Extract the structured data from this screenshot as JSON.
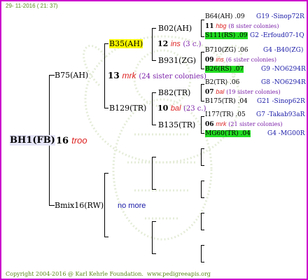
{
  "header": {
    "date": "29- 11-2016 ( 21: 37)"
  },
  "footer": {
    "copyright": "Copyright 2004-2016 @ Karl Kehrle Foundation.",
    "url": "www.pedigreeapis.org"
  },
  "subject": {
    "name": "BH1(FB)",
    "num": "16",
    "breeder": "troo"
  },
  "father_gen1": {
    "name": "B75(AH)",
    "num": "13",
    "breeder": "mrk",
    "sisters": "(24 sister colonies)"
  },
  "mother_gen1": {
    "name": "Bmix16(RW)",
    "note": "no more"
  },
  "g2a": {
    "name": "B35(AH)",
    "num": "12",
    "breeder": "ins",
    "sisters": "(3 c.)"
  },
  "g2b": {
    "name": "B129(TR)",
    "num": "10",
    "breeder": "bal",
    "sisters": "(23 c.)"
  },
  "g3": {
    "b02": "B02(AH)",
    "b931": "B931(ZG)",
    "b82": "B82(TR)",
    "b135": "B135(TR)"
  },
  "g4": [
    {
      "name": "B64(AH)",
      "score": ".09",
      "code": "G19 -Sinop72R",
      "highlight": ""
    },
    {
      "num": "11",
      "breeder": "hbg",
      "sisters": "(8 sister colonies)"
    },
    {
      "name": "S111(RS)",
      "score": ".09",
      "code": "G2 -Erfoud07-1Q",
      "highlight": "green"
    },
    {
      "name": "B710(ZG)",
      "score": ".06",
      "code": "G4 -B40(ZG)",
      "highlight": ""
    },
    {
      "num": "09",
      "breeder": "ins",
      "sisters": "(6 sister colonies)"
    },
    {
      "name": "B26(RS)",
      "score": ".07",
      "code": "G9 -NO6294R",
      "highlight": "green"
    },
    {
      "name": "B2(TR)",
      "score": ".06",
      "code": "G8 -NO6294R",
      "highlight": ""
    },
    {
      "num": "07",
      "breeder": "bal",
      "sisters": "(19 sister colonies)"
    },
    {
      "name": "B175(TR)",
      "score": ".04",
      "code": "G21 -Sinop62R",
      "highlight": ""
    },
    {
      "name": "I177(TR)",
      "score": ".05",
      "code": "G7 -Takab93aR",
      "highlight": ""
    },
    {
      "num": "06",
      "breeder": "mrk",
      "sisters": "(21 sister colonies)"
    },
    {
      "name": "MG60(TR)",
      "score": ".04",
      "code": "G4 -MG00R",
      "highlight": "green"
    }
  ],
  "colors": {
    "border": "#cc00cc",
    "highlight_yellow": "#ffff00",
    "highlight_green": "#22dd22",
    "breeder_red": "#dd2222",
    "sister_purple": "#7a1fa8",
    "code_blue": "#1a1aa8",
    "meta_green": "#5a8a1a"
  }
}
